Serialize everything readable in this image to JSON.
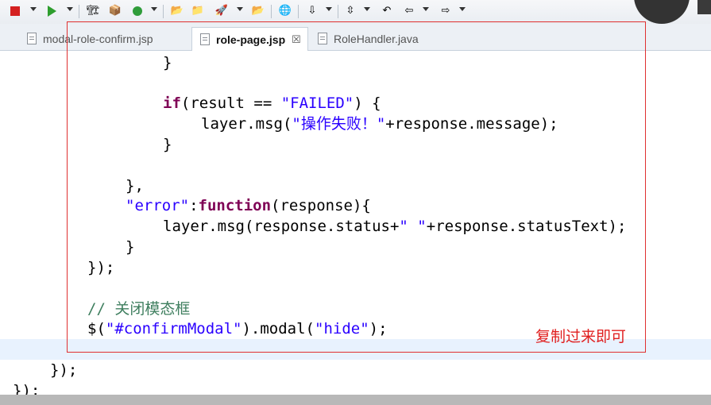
{
  "toolbar": {
    "icons": [
      "stop-icon",
      "run-icon",
      "build-icon",
      "package-icon",
      "refresh-icon",
      "open-folder-icon",
      "folder-icon",
      "rocket-icon",
      "open-file-icon",
      "globe-icon",
      "download-icon",
      "pin-icon",
      "back-history-icon",
      "back-arrow-icon",
      "forward-arrow-icon"
    ]
  },
  "tabs": [
    {
      "label": "modal-role-confirm.jsp"
    },
    {
      "label": "role-page.jsp",
      "close": "☒"
    },
    {
      "label": "RoleHandler.java"
    }
  ],
  "code": {
    "l1": "}",
    "l2_kw": "if",
    "l2_a": "(result == ",
    "l2_str": "\"FAILED\"",
    "l2_b": ") {",
    "l3_a": "layer.msg(",
    "l3_str": "\"操作失败！\"",
    "l3_b": "+response.message);",
    "l4": "}",
    "l5": "},",
    "l6_str": "\"error\"",
    "l6_a": ":",
    "l6_kw": "function",
    "l6_b": "(response){",
    "l7_a": "layer.msg(response.status+",
    "l7_str": "\" \"",
    "l7_b": "+response.statusText);",
    "l8": "}",
    "l9": "});",
    "l10_cm": "// 关闭模态框",
    "l11_a": "$(",
    "l11_str1": "\"#confirmModal\"",
    "l11_b": ").modal(",
    "l11_str2": "\"hide\"",
    "l11_c": ");",
    "l12": "});",
    "l13": "});"
  },
  "annotation": {
    "text": "复制过来即可",
    "color": "#e02020"
  },
  "colors": {
    "keyword": "#7f0055",
    "string": "#2a00ff",
    "comment": "#3f7f5f",
    "current_line": "#e8f2fe"
  }
}
